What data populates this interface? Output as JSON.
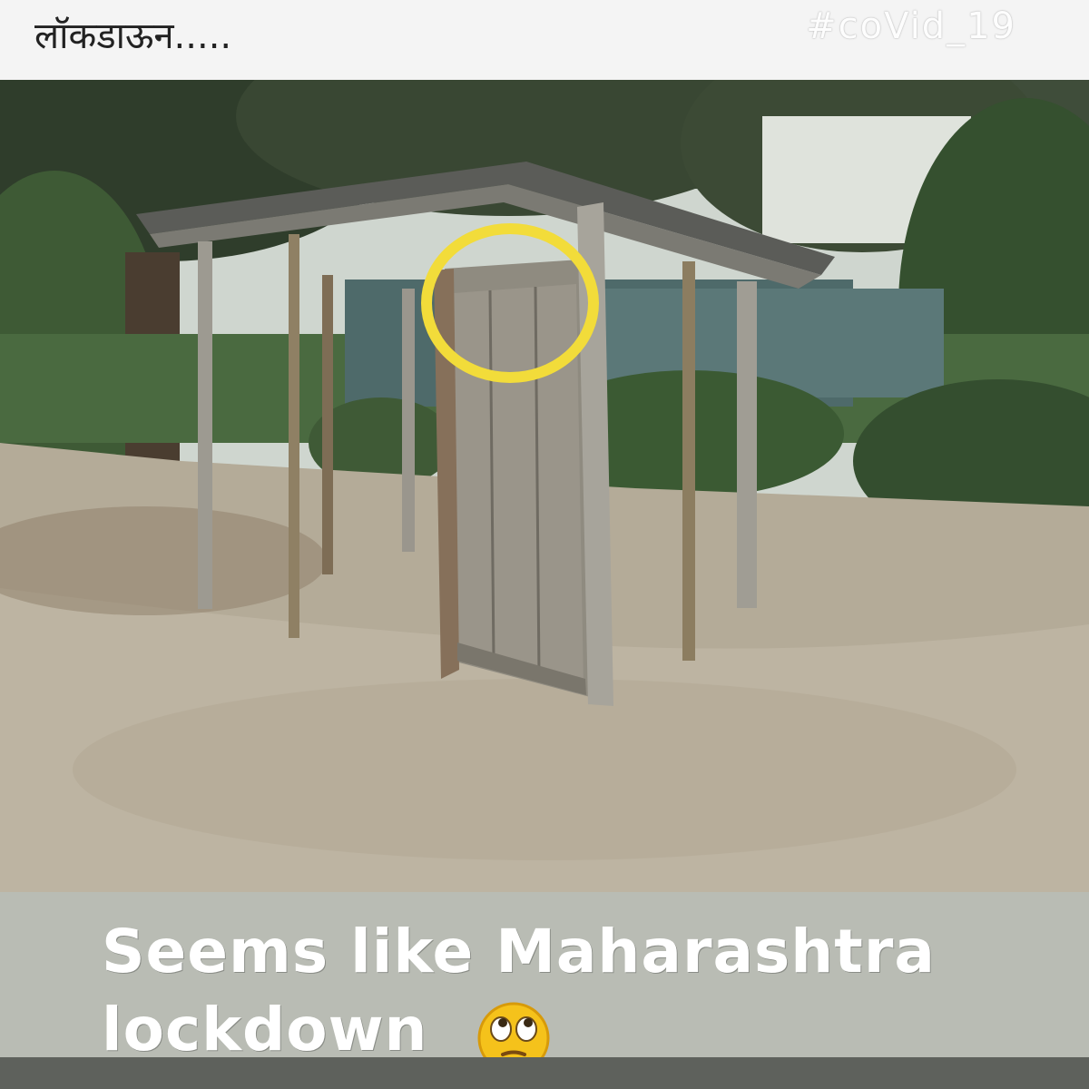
{
  "header": {
    "title": "लॉकडाऊन.....",
    "hashtag": "#coVid_19"
  },
  "photo": {
    "description_icon": "outhouse-photo",
    "highlight_color": "#f2dc3a"
  },
  "caption": {
    "line1": "Seems like Maharashtra",
    "line2": "lockdown",
    "emoji": "eye-roll-emoji"
  },
  "colors": {
    "caption_background": "#b9bcb4",
    "caption_text": "#ffffff",
    "footer_bar": "#5e615c"
  }
}
